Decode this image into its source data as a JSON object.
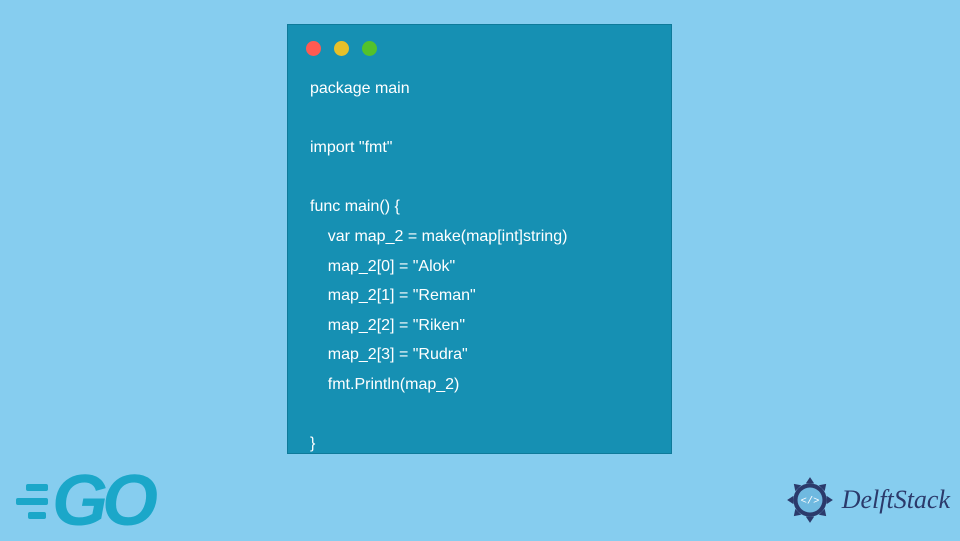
{
  "code": {
    "lines": [
      "package main",
      "",
      "import \"fmt\"",
      "",
      "func main() {",
      "    var map_2 = make(map[int]string)",
      "    map_2[0] = \"Alok\"",
      "    map_2[1] = \"Reman\"",
      "    map_2[2] = \"Riken\"",
      "    map_2[3] = \"Rudra\"",
      "    fmt.Println(map_2)",
      "",
      "}"
    ]
  },
  "go_logo": {
    "text": "GO"
  },
  "delft": {
    "text": "DelftStack"
  }
}
